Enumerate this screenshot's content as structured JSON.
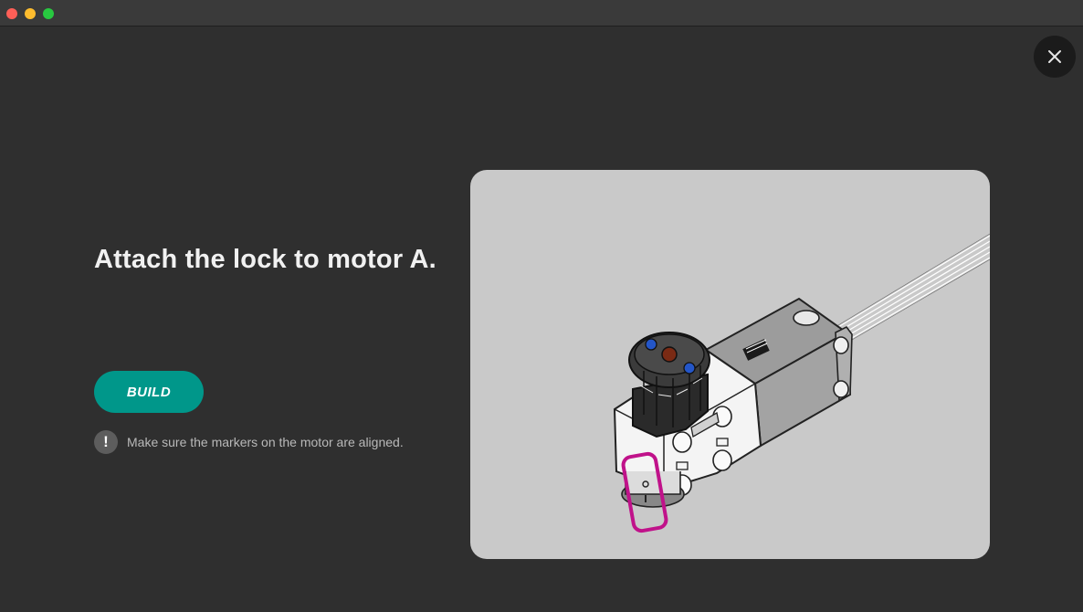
{
  "window": {
    "titlebar": {
      "buttons": [
        "close",
        "minimize",
        "maximize"
      ]
    }
  },
  "instruction": {
    "title": "Attach the lock to motor A.",
    "build_label": "BUILD",
    "note_icon": "!",
    "note_text": "Make sure the markers on the motor are aligned."
  },
  "illustration": {
    "subject": "motor-with-lock-icon",
    "highlight_color": "#c0128a",
    "background_color": "#c9c9c9"
  },
  "colors": {
    "background": "#2f2f2f",
    "accent": "#00978a",
    "text_primary": "#f1f1f1",
    "text_secondary": "#b9b9b9"
  }
}
